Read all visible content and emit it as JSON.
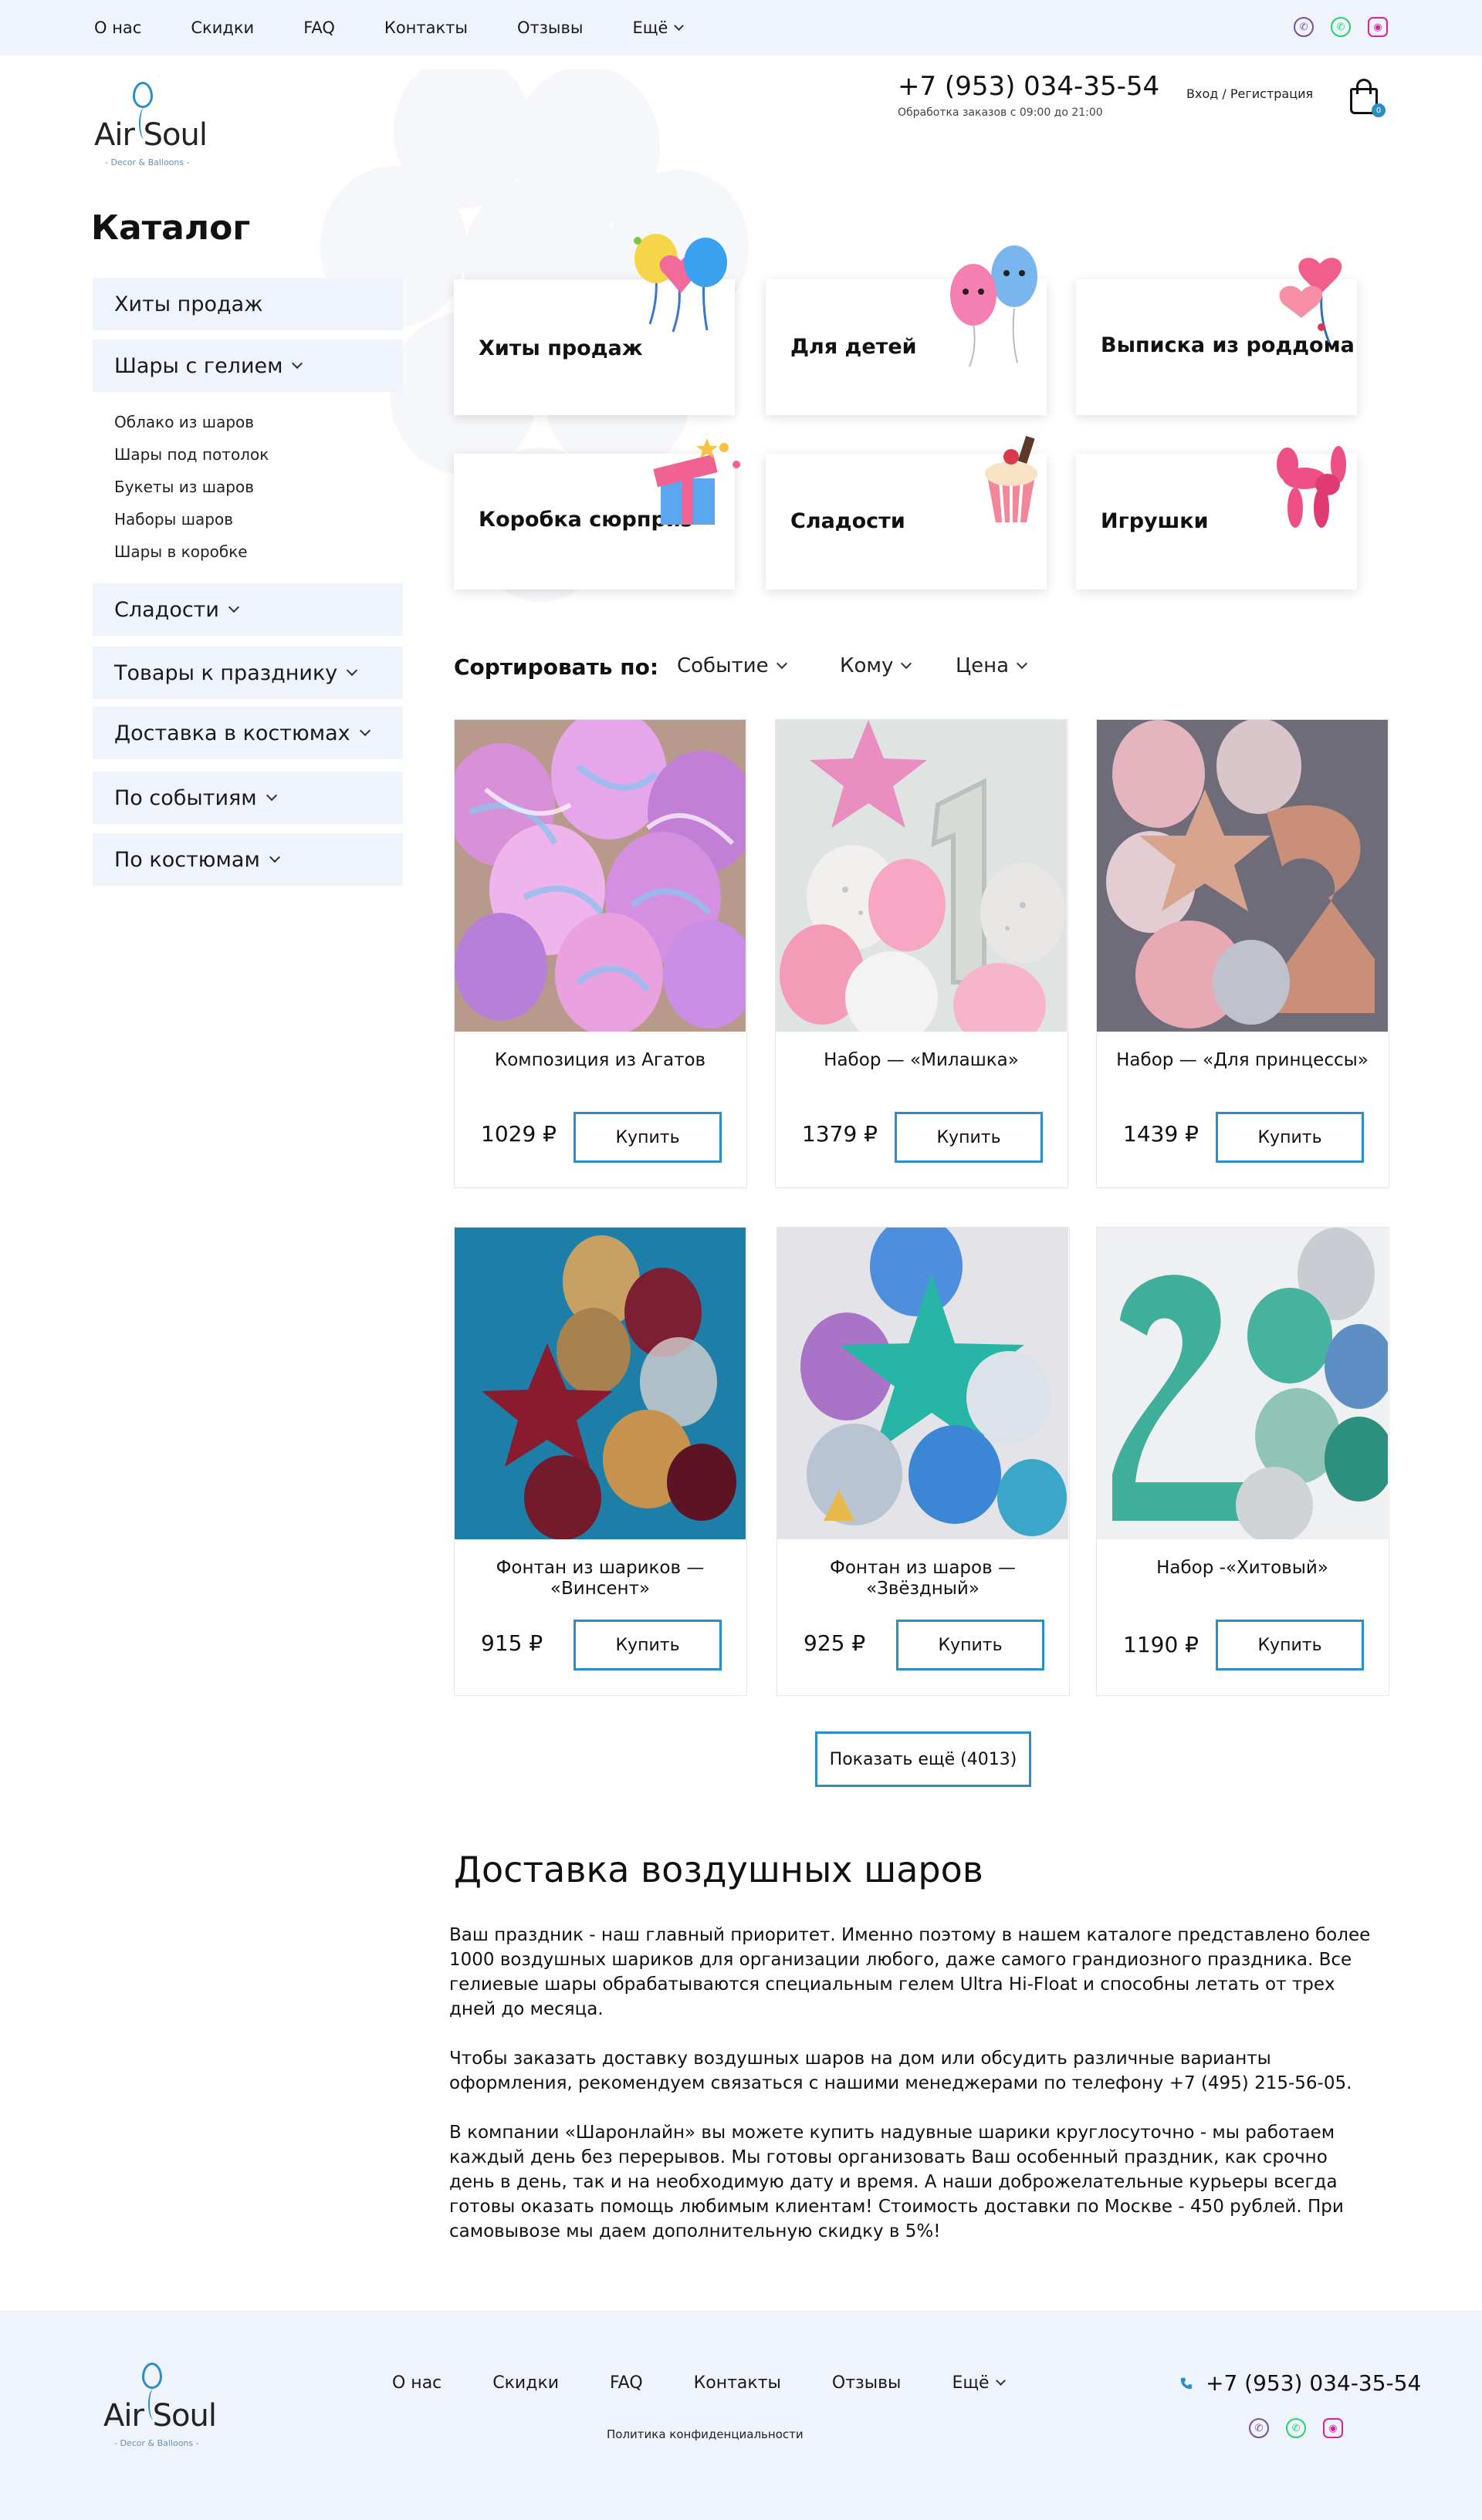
{
  "topbar": {
    "nav": [
      {
        "label": "О нас"
      },
      {
        "label": "Скидки"
      },
      {
        "label": "FAQ"
      },
      {
        "label": "Контакты"
      },
      {
        "label": "Отзывы"
      },
      {
        "label": "Ещё"
      }
    ],
    "social": [
      "viber-icon",
      "whatsapp-icon",
      "instagram-icon"
    ]
  },
  "header": {
    "logo_text": "Air Soul",
    "logo_sub": "- Decor & Balloons -",
    "phone": "+7 (953) 034-35-54",
    "hours": "Обработка заказов с 09:00 до 21:00",
    "auth": "Вход / Регистрация",
    "cart_count": "0"
  },
  "sidebar": {
    "title": "Каталог",
    "items": [
      {
        "label": "Хиты продаж"
      },
      {
        "label": "Шары с гелием"
      },
      {
        "label": "Сладости"
      },
      {
        "label": "Товары к празднику"
      },
      {
        "label": "Доставка в костюмах"
      },
      {
        "label": "По событиям"
      },
      {
        "label": "По костюмам"
      }
    ],
    "subitems": [
      {
        "label": "Облако из шаров"
      },
      {
        "label": "Шары под потолок"
      },
      {
        "label": "Букеты из шаров"
      },
      {
        "label": "Наборы шаров"
      },
      {
        "label": "Шары в коробке"
      }
    ]
  },
  "categories": [
    {
      "label": "Хиты продаж"
    },
    {
      "label": "Для детей"
    },
    {
      "label": "Выписка из роддома"
    },
    {
      "label": "Коробка сюрприз"
    },
    {
      "label": "Сладости"
    },
    {
      "label": "Игрушки"
    }
  ],
  "sort": {
    "label": "Сортировать по:",
    "options": [
      {
        "label": "Событие"
      },
      {
        "label": "Кому"
      },
      {
        "label": "Цена"
      }
    ]
  },
  "products": [
    {
      "name": "Композиция из Агатов",
      "price": "1029 ₽",
      "buy": "Купить"
    },
    {
      "name": "Набор — «Милашка»",
      "price": "1379 ₽",
      "buy": "Купить"
    },
    {
      "name": "Набор — «Для принцессы»",
      "price": "1439 ₽",
      "buy": "Купить"
    },
    {
      "name": "Фонтан из шариков — «Винсент»",
      "price": "915 ₽",
      "buy": "Купить"
    },
    {
      "name": "Фонтан из шаров — «Звёздный»",
      "price": "925 ₽",
      "buy": "Купить"
    },
    {
      "name": "Набор -«Хитовый»",
      "price": "1190 ₽",
      "buy": "Купить"
    }
  ],
  "more_button": "Показать ещё (4013)",
  "seo": {
    "title": "Доставка воздушных шаров",
    "paragraphs": [
      "Ваш праздник - наш главный приоритет. Именно поэтому в нашем каталоге представлено более 1000 воздушных шариков для организации любого, даже самого грандиозного праздника. Все гелиевые шары обрабатываются специальным гелем Ultra Hi-Float и способны летать от трех дней до месяца.",
      "Чтобы заказать доставку воздушных шаров на дом или обсудить различные варианты оформления, рекомендуем связаться с нашими менеджерами по телефону +7 (495) 215-56-05.",
      "В компании «Шаронлайн» вы можете купить надувные шарики круглосуточно - мы работаем каждый день без перерывов. Мы готовы организовать Ваш особенный праздник, как срочно день в день, так и на необходимую дату и время. А наши доброжелательные курьеры всегда готовы оказать помощь любимым клиентам! Стоимость доставки по Москве - 450 рублей. При самовывозе мы даем дополнительную скидку в 5%!"
    ]
  },
  "footer": {
    "nav": [
      {
        "label": "О нас"
      },
      {
        "label": "Скидки"
      },
      {
        "label": "FAQ"
      },
      {
        "label": "Контакты"
      },
      {
        "label": "Отзывы"
      },
      {
        "label": "Ещё"
      }
    ],
    "policy": "Политика конфиденциальности",
    "phone": "+7 (953) 034-35-54"
  },
  "colors": {
    "accent": "#2b8fc6",
    "light_bg": "#eef3fc"
  }
}
